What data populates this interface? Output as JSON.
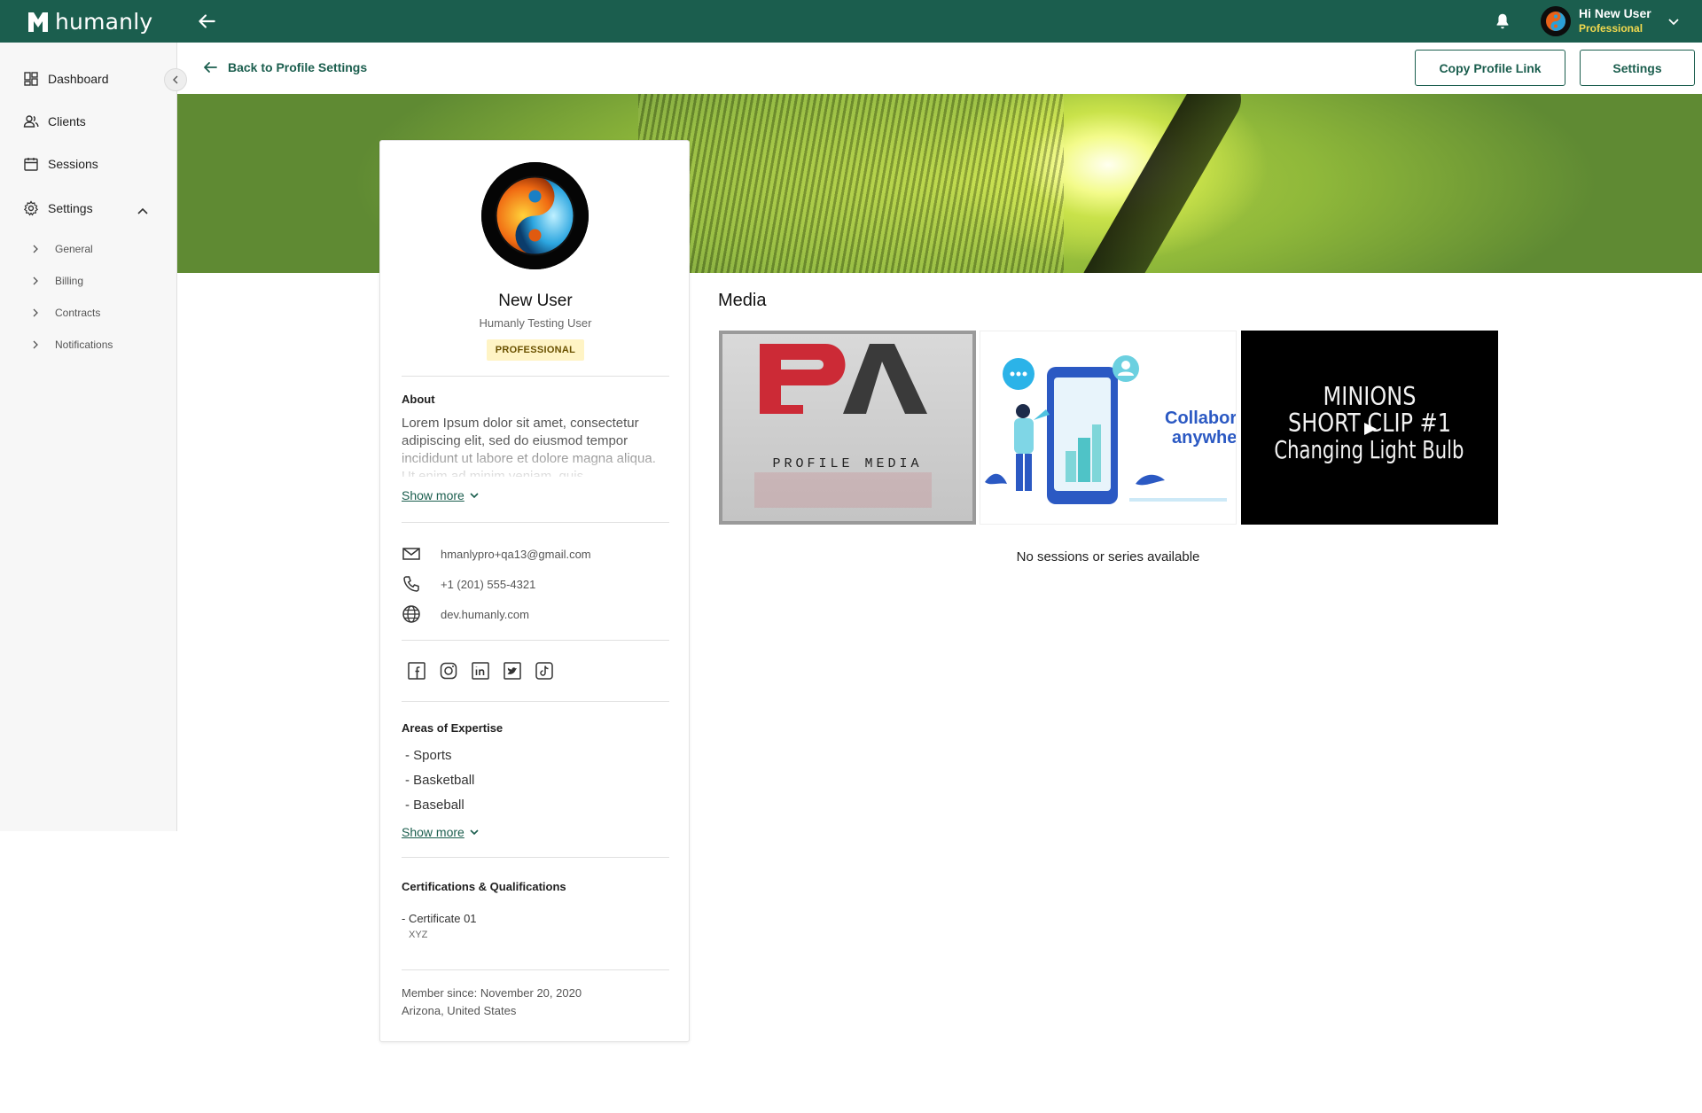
{
  "app": {
    "brand": "humanly",
    "user_greeting": "Hi New User",
    "user_role": "Professional"
  },
  "sidebar": {
    "items": [
      {
        "label": "Dashboard",
        "icon": "dashboard-icon"
      },
      {
        "label": "Clients",
        "icon": "clients-icon"
      },
      {
        "label": "Sessions",
        "icon": "calendar-icon"
      },
      {
        "label": "Settings",
        "icon": "gear-icon"
      }
    ],
    "settings_sub": [
      {
        "label": "General"
      },
      {
        "label": "Billing"
      },
      {
        "label": "Contracts"
      },
      {
        "label": "Notifications"
      }
    ]
  },
  "header": {
    "back_label": "Back to Profile Settings",
    "copy_link_label": "Copy Profile Link",
    "settings_label": "Settings"
  },
  "profile": {
    "name": "New User",
    "subtitle": "Humanly Testing User",
    "badge": "PROFESSIONAL",
    "about_heading": "About",
    "about_text": "Lorem Ipsum dolor sit amet, consectetur adipiscing elit, sed do eiusmod tempor incididunt ut labore et dolore magna aliqua. Ut enim ad minim veniam, quis",
    "show_more": "Show more",
    "email": "hmanlypro+qa13@gmail.com",
    "phone": "+1 (201) 555-4321",
    "website": "dev.humanly.com",
    "expertise_heading": "Areas of Expertise",
    "expertise": [
      "- Sports",
      "- Basketball",
      "- Baseball"
    ],
    "certs_heading": "Certifications & Qualifications",
    "cert_name": "- Certificate 01",
    "cert_issuer": "XYZ",
    "member_since": "Member since: November 20, 2020",
    "location": "Arizona, United States"
  },
  "media": {
    "title": "Media",
    "thumb1_text": "PROFILE MEDIA",
    "thumb2_text_1": "Collabor",
    "thumb2_text_2": "anywhe",
    "thumb3_lines": [
      "MINIONS",
      "SHORT CLIP #1",
      "Changing Light Bulb"
    ],
    "empty_message": "No sessions or series available"
  },
  "colors": {
    "brand_green": "#1b5e4e",
    "role_yellow": "#f2d94e",
    "badge_bg": "#fff4c5"
  }
}
